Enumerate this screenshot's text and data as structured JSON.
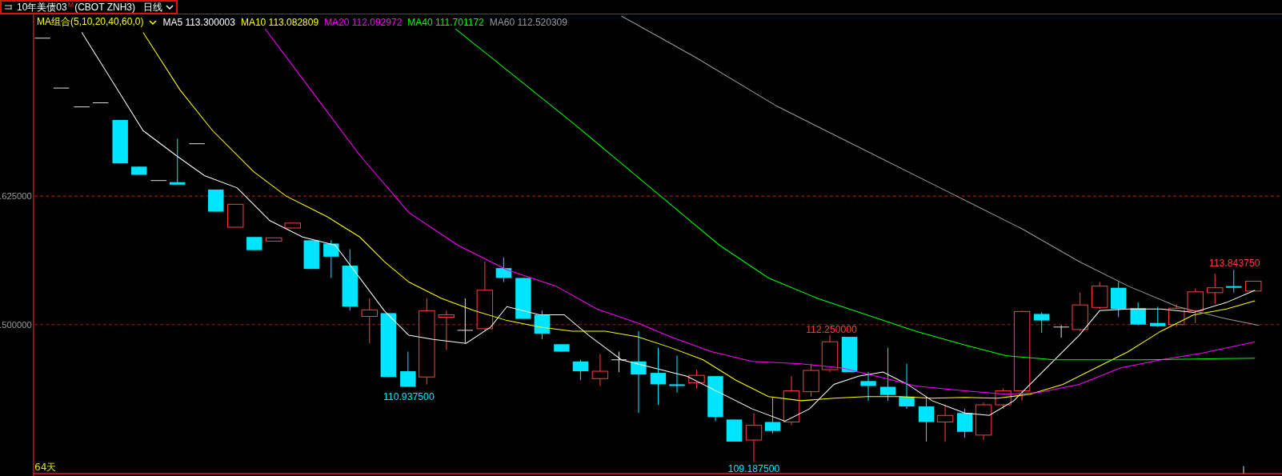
{
  "header": {
    "title": "10年美债03",
    "flag": "M",
    "code": "(CBOT ZNH3)",
    "period": "日线"
  },
  "legend": {
    "label": "MA组合(5,10,20,40,60,0)",
    "lines": [
      {
        "name": "MA5",
        "value": "113.300003",
        "color": "#ffffff"
      },
      {
        "name": "MA10",
        "value": "113.082809",
        "color": "#ffff00"
      },
      {
        "name": "MA20",
        "value": "112.092972",
        "color": "#ff00ff"
      },
      {
        "name": "MA40",
        "value": "111.701172",
        "color": "#00ff00"
      },
      {
        "name": "MA60",
        "value": "112.520309",
        "color": "#9a9a9a"
      }
    ]
  },
  "price_axis": {
    "labels": [
      ".625000",
      ".500000"
    ]
  },
  "annotations": [
    {
      "text": "113.843750",
      "kind": "high"
    },
    {
      "text": "112.250000",
      "kind": "high"
    },
    {
      "text": "110.937500",
      "kind": "low"
    },
    {
      "text": "109.187500",
      "kind": "low"
    }
  ],
  "footer": {
    "days": "64天"
  }
}
